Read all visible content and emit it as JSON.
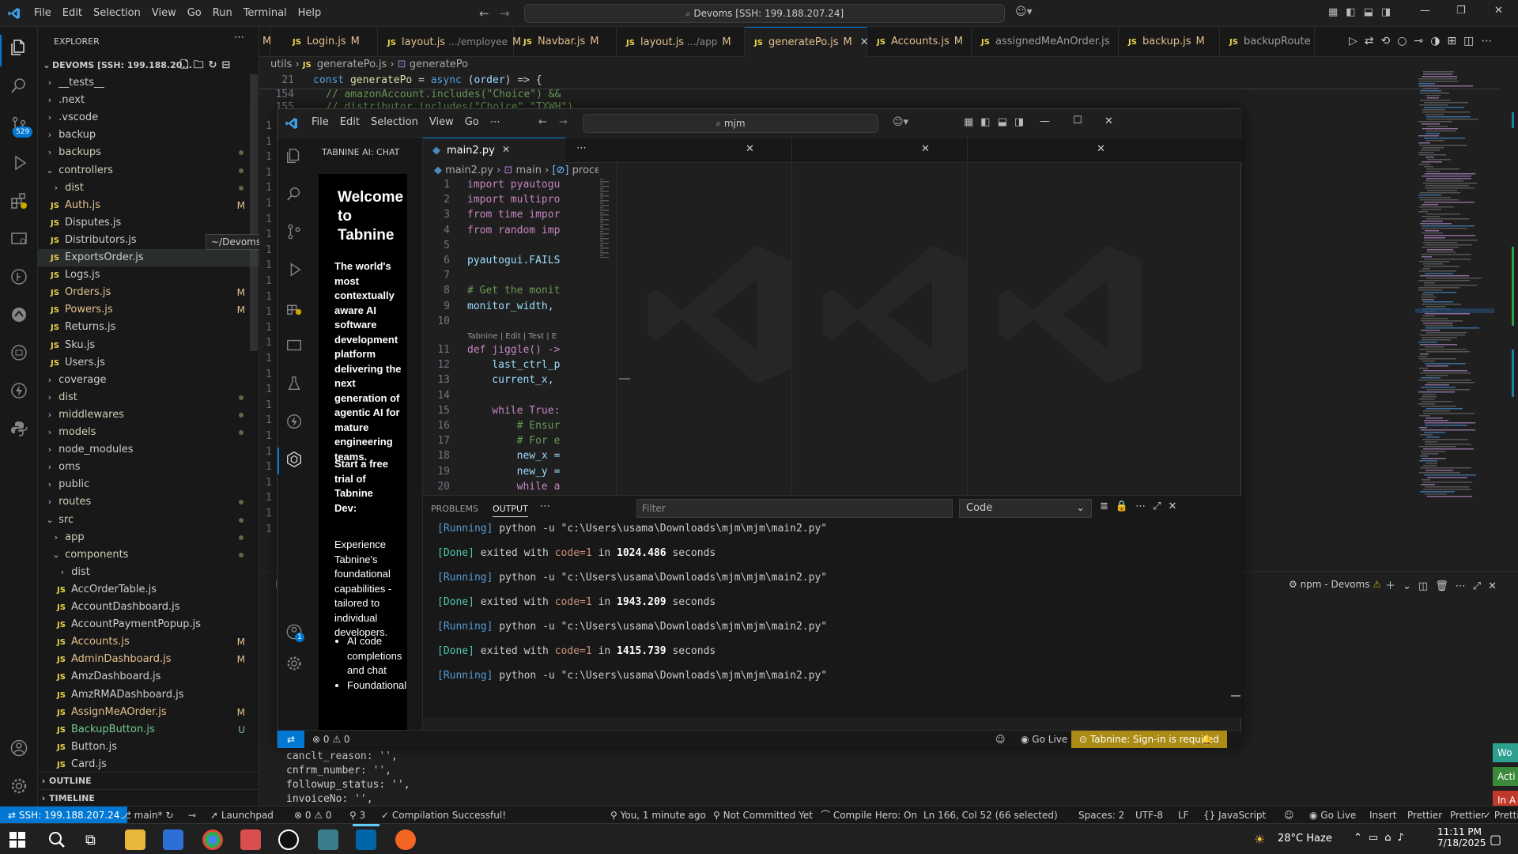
{
  "titlebar": {
    "menu": [
      "File",
      "Edit",
      "Selection",
      "View",
      "Go",
      "Run",
      "Terminal",
      "Help"
    ],
    "search": "Devoms [SSH: 199.188.207.24]"
  },
  "sidebar": {
    "title": "EXPLORER",
    "root": "DEVOMS [SSH: 199.188.20...",
    "tooltip": "~/Devoms/controllers/Po",
    "items": [
      {
        "label": "__tests__",
        "type": "folder",
        "indent": 1
      },
      {
        "label": ".next",
        "type": "folder",
        "indent": 1
      },
      {
        "label": ".vscode",
        "type": "folder",
        "indent": 1
      },
      {
        "label": "backup",
        "type": "folder",
        "indent": 1
      },
      {
        "label": "backups",
        "type": "folder",
        "indent": 1,
        "dot": true
      },
      {
        "label": "controllers",
        "type": "folder-open",
        "indent": 1,
        "dot": true
      },
      {
        "label": "dist",
        "type": "folder",
        "indent": 2,
        "dot": true
      },
      {
        "label": "Auth.js",
        "type": "file",
        "indent": 2,
        "badge": "M"
      },
      {
        "label": "Disputes.js",
        "type": "file",
        "indent": 2
      },
      {
        "label": "Distributors.js",
        "type": "file",
        "indent": 2
      },
      {
        "label": "ExportsOrder.js",
        "type": "file",
        "indent": 2,
        "selected": true
      },
      {
        "label": "Logs.js",
        "type": "file",
        "indent": 2
      },
      {
        "label": "Orders.js",
        "type": "file",
        "indent": 2,
        "badge": "M"
      },
      {
        "label": "Powers.js",
        "type": "file",
        "indent": 2,
        "badge": "M"
      },
      {
        "label": "Returns.js",
        "type": "file",
        "indent": 2
      },
      {
        "label": "Sku.js",
        "type": "file",
        "indent": 2
      },
      {
        "label": "Users.js",
        "type": "file",
        "indent": 2
      },
      {
        "label": "coverage",
        "type": "folder",
        "indent": 1
      },
      {
        "label": "dist",
        "type": "folder",
        "indent": 1,
        "dot": true
      },
      {
        "label": "middlewares",
        "type": "folder",
        "indent": 1,
        "dot": true
      },
      {
        "label": "models",
        "type": "folder",
        "indent": 1,
        "dot": true
      },
      {
        "label": "node_modules",
        "type": "folder",
        "indent": 1
      },
      {
        "label": "oms",
        "type": "folder",
        "indent": 1
      },
      {
        "label": "public",
        "type": "folder",
        "indent": 1
      },
      {
        "label": "routes",
        "type": "folder",
        "indent": 1,
        "dot": true
      },
      {
        "label": "src",
        "type": "folder-open",
        "indent": 1,
        "dot": true
      },
      {
        "label": "app",
        "type": "folder",
        "indent": 2,
        "dot": true
      },
      {
        "label": "components",
        "type": "folder-open",
        "indent": 2,
        "dot": true
      },
      {
        "label": "dist",
        "type": "folder",
        "indent": 3
      },
      {
        "label": "AccOrderTable.js",
        "type": "file",
        "indent": 3
      },
      {
        "label": "AccountDashboard.js",
        "type": "file",
        "indent": 3
      },
      {
        "label": "AccountPaymentPopup.js",
        "type": "file",
        "indent": 3
      },
      {
        "label": "Accounts.js",
        "type": "file",
        "indent": 3,
        "badge": "M"
      },
      {
        "label": "AdminDashboard.js",
        "type": "file",
        "indent": 3,
        "badge": "M"
      },
      {
        "label": "AmzDashboard.js",
        "type": "file",
        "indent": 3
      },
      {
        "label": "AmzRMADashboard.js",
        "type": "file",
        "indent": 3
      },
      {
        "label": "AssignMeAOrder.js",
        "type": "file",
        "indent": 3,
        "badge": "M"
      },
      {
        "label": "BackupButton.js",
        "type": "file",
        "indent": 3,
        "badge": "U"
      },
      {
        "label": "Button.js",
        "type": "file",
        "indent": 3
      },
      {
        "label": "Card.js",
        "type": "file",
        "indent": 3
      }
    ],
    "outline": "OUTLINE",
    "timeline": "TIMELINE"
  },
  "tabs": [
    {
      "label": "Login.js",
      "suffix": "M",
      "active": false
    },
    {
      "label": "layout.js",
      "desc": ".../employee",
      "suffix": "M",
      "active": false
    },
    {
      "label": "Navbar.js",
      "suffix": "M",
      "active": false
    },
    {
      "label": "layout.js",
      "desc": ".../app",
      "suffix": "M",
      "active": false
    },
    {
      "label": "generatePo.js",
      "suffix": "M",
      "active": true
    },
    {
      "label": "Accounts.js",
      "suffix": "M",
      "active": false
    },
    {
      "label": "assignedMeAnOrder.js",
      "suffix": "",
      "active": false
    },
    {
      "label": "backup.js",
      "suffix": "M",
      "active": false
    },
    {
      "label": "backupRoute",
      "suffix": "",
      "active": false
    }
  ],
  "breadcrumb": {
    "a": "utils",
    "b": "generatePo.js",
    "c": "generatePo"
  },
  "outer_code": {
    "line21": "21",
    "code21": "const generatePo = async (order) => {",
    "line154": "154",
    "code154": "//   amazonAccount.includes(\"Choice\") &&",
    "line155": "155",
    "code155": "//   distributor.includes(\"Choice\",\"TXWH\")"
  },
  "inner": {
    "menu": [
      "File",
      "Edit",
      "Selection",
      "View",
      "Go"
    ],
    "search": "mjm",
    "chat_title": "TABNINE AI: CHAT",
    "tab_label": "main2.py",
    "breadcrumb": {
      "a": "main2.py",
      "b": "main",
      "c": "proce"
    },
    "welcome": "Welcome to Tabnine",
    "desc": "The world's most contextually aware AI software development platform delivering the next generation of agentic AI for mature engineering teams.",
    "trial": "Start a free trial of Tabnine Dev:",
    "trial_desc": "Experience Tabnine's foundational capabilities - tailored to individual developers.",
    "bullets": [
      "AI code completions and chat",
      "Foundational"
    ],
    "codelens": "Tabnine | Edit | Test | E",
    "code": [
      {
        "n": "1",
        "t": "import pyautogu"
      },
      {
        "n": "2",
        "t": "import multipro"
      },
      {
        "n": "3",
        "t": "from time impor"
      },
      {
        "n": "4",
        "t": "from random imp"
      },
      {
        "n": "5",
        "t": ""
      },
      {
        "n": "6",
        "t": "pyautogui.FAILS"
      },
      {
        "n": "7",
        "t": ""
      },
      {
        "n": "8",
        "t": "# Get the monit"
      },
      {
        "n": "9",
        "t": "monitor_width,"
      },
      {
        "n": "10",
        "t": ""
      },
      {
        "n": "11",
        "t": "def jiggle() ->"
      },
      {
        "n": "12",
        "t": "    last_ctrl_p"
      },
      {
        "n": "13",
        "t": "    current_x,"
      },
      {
        "n": "14",
        "t": ""
      },
      {
        "n": "15",
        "t": "    while True:"
      },
      {
        "n": "16",
        "t": "        # Ensur"
      },
      {
        "n": "17",
        "t": "        # For e"
      },
      {
        "n": "18",
        "t": "        new_x ="
      },
      {
        "n": "19",
        "t": "        new_y ="
      },
      {
        "n": "20",
        "t": "        while a"
      }
    ],
    "panel_tabs": {
      "problems": "PROBLEMS",
      "output": "OUTPUT",
      "filter": "Filter",
      "dropdown": "Code"
    },
    "output": [
      {
        "kind": "run",
        "tag": "[Running]",
        "text": " python -u \"c:\\Users\\usama\\Downloads\\mjm\\mjm\\main2.py\""
      },
      {
        "kind": "done",
        "tag": "[Done]",
        "text": " exited with ",
        "code": "code=1",
        "mid": " in ",
        "secs": "1024.486",
        "end": " seconds"
      },
      {
        "kind": "run",
        "tag": "[Running]",
        "text": " python -u \"c:\\Users\\usama\\Downloads\\mjm\\mjm\\main2.py\""
      },
      {
        "kind": "done",
        "tag": "[Done]",
        "text": " exited with ",
        "code": "code=1",
        "mid": " in ",
        "secs": "1943.209",
        "end": " seconds"
      },
      {
        "kind": "run",
        "tag": "[Running]",
        "text": " python -u \"c:\\Users\\usama\\Downloads\\mjm\\mjm\\main2.py\""
      },
      {
        "kind": "done",
        "tag": "[Done]",
        "text": " exited with ",
        "code": "code=1",
        "mid": " in ",
        "secs": "1415.739",
        "end": " seconds"
      },
      {
        "kind": "run",
        "tag": "[Running]",
        "text": " python -u \"c:\\Users\\usama\\Downloads\\mjm\\mjm\\main2.py\""
      }
    ],
    "status": {
      "errors": "0",
      "warnings": "0",
      "golive": "Go Live",
      "tabnine": "Tabnine: Sign-in is required"
    }
  },
  "terminal": {
    "label": "npm - Devoms",
    "lines": [
      "canclt_reason: '',",
      "cnfrm_number: '',",
      "followup_status: '',",
      "invoiceNo: '',"
    ]
  },
  "statusbar": {
    "remote": "SSH: 199.188.207.24",
    "branch": "main*",
    "launchpad": "Launchpad",
    "errors": "0",
    "warnings": "0",
    "ports": "3",
    "compile": "Compilation Successful!",
    "blame": "You, 1 minute ago",
    "commit": "Not Committed Yet",
    "hero": "Compile Hero: On",
    "position": "Ln 166, Col 52 (66 selected)",
    "spaces": "Spaces: 2",
    "encoding": "UTF-8",
    "eol": "LF",
    "language": "JavaScript",
    "golive": "Go Live",
    "insert": "Insert",
    "prettier1": "Prettier",
    "prettier2": "Prettier",
    "prettier3": "Prettier"
  },
  "sidebar_badge": "529",
  "notifications": [
    "Wo",
    "Acti",
    "In A"
  ],
  "taskbar": {
    "weather": "28°C  Haze",
    "time": "11:11 PM",
    "date": "7/18/2025"
  },
  "colors": {
    "accent": "#0078d4",
    "tabnine_status": "#ab8b14",
    "remote": "#0078d4"
  }
}
